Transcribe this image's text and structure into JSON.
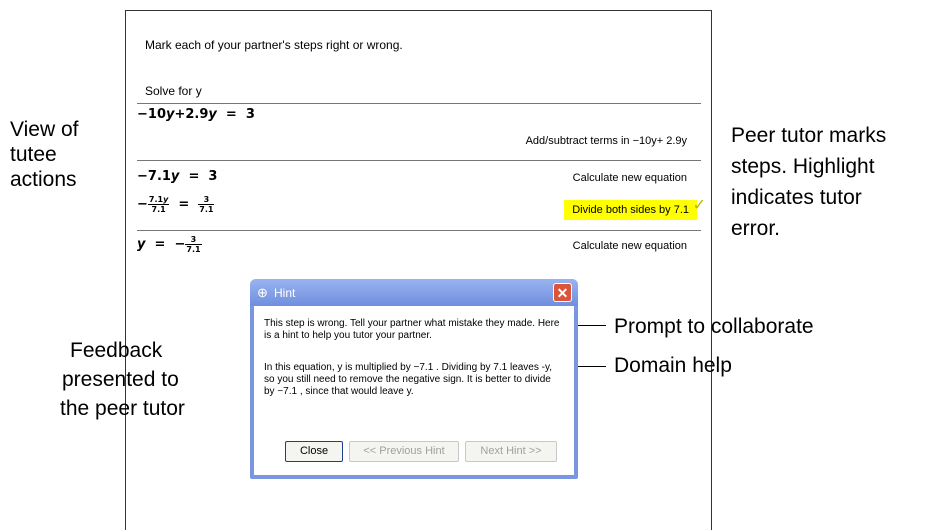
{
  "panel": {
    "instruction": "Mark each of your partner's steps right or wrong.",
    "solve_label": "Solve for y",
    "steps": [
      {
        "equation": "-10y+2.9y = 3",
        "action": "Add/subtract terms in −10y+ 2.9y"
      },
      {
        "equation": "-7.1y = 3",
        "action": "Calculate new equation"
      },
      {
        "equation": "-7.1y/7.1 = 3/7.1",
        "action": "Divide both sides by 7.1",
        "highlighted": true,
        "marked": "✓"
      },
      {
        "equation": "y = -3/7.1",
        "action": "Calculate new equation"
      }
    ]
  },
  "annotations": {
    "view_of_tutee": [
      "View of",
      "tutee",
      "actions"
    ],
    "peer_tutor_marks": [
      "Peer tutor marks",
      "steps. Highlight",
      "indicates tutor",
      "error."
    ],
    "feedback": [
      "Feedback",
      "presented to",
      "the peer tutor"
    ],
    "prompt_collab": "Prompt to collaborate",
    "domain_help": "Domain help"
  },
  "dialog": {
    "title": "Hint",
    "paragraph1": "This step is wrong. Tell your partner what mistake they made. Here is a hint to help you tutor your partner.",
    "paragraph2": "In this equation, y is multiplied by −7.1 . Dividing by 7.1 leaves -y, so you still need to remove the negative sign. It is better to divide by −7.1 , since that would leave y.",
    "buttons": {
      "close": "Close",
      "previous": "<< Previous Hint",
      "next": "Next Hint >>"
    }
  },
  "colors": {
    "highlight": "#ffff00",
    "dialog_frame": "#7a96e0",
    "close_button": "#d9563a"
  }
}
